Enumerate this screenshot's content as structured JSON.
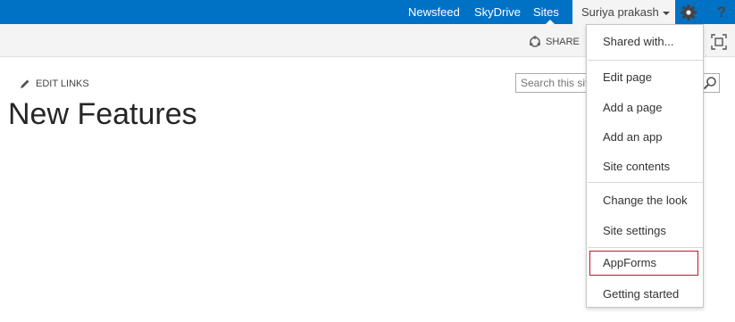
{
  "suite_bar": {
    "nav": [
      "Newsfeed",
      "SkyDrive",
      "Sites"
    ],
    "user_name": "Suriya prakash",
    "help_label": "?",
    "colors": {
      "bar": "#0072c6",
      "user_bg": "#f4f4f4"
    }
  },
  "ribbon": {
    "share_label": "SHARE"
  },
  "page": {
    "edit_links_label": "EDIT LINKS",
    "title": "New Features",
    "search_placeholder": "Search this site"
  },
  "menu": {
    "items": [
      "Shared with...",
      "Edit page",
      "Add a page",
      "Add an app",
      "Site contents",
      "Change the look",
      "Site settings",
      "AppForms",
      "Getting started"
    ],
    "highlighted_item": "AppForms",
    "highlight_color": "#c8102e"
  }
}
